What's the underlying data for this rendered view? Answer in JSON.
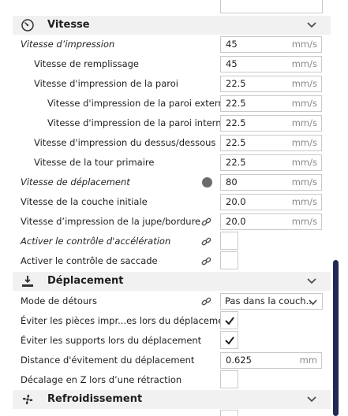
{
  "speed_section": {
    "title": "Vitesse",
    "rows": [
      {
        "label": "Vitesse d’impression",
        "value": "45",
        "unit": "mm/s"
      },
      {
        "label": "Vitesse de remplissage",
        "value": "45",
        "unit": "mm/s"
      },
      {
        "label": "Vitesse d'impression de la paroi",
        "value": "22.5",
        "unit": "mm/s"
      },
      {
        "label": "Vitesse d'impression de la paroi externe",
        "value": "22.5",
        "unit": "mm/s"
      },
      {
        "label": "Vitesse d'impression de la paroi interne",
        "value": "22.5",
        "unit": "mm/s"
      },
      {
        "label": "Vitesse d'impression du dessus/dessous",
        "value": "22.5",
        "unit": "mm/s"
      },
      {
        "label": "Vitesse de la tour primaire",
        "value": "22.5",
        "unit": "mm/s"
      },
      {
        "label": "Vitesse de déplacement",
        "value": "80",
        "unit": "mm/s"
      },
      {
        "label": "Vitesse de la couche initiale",
        "value": "20.0",
        "unit": "mm/s"
      },
      {
        "label": "Vitesse d’impression de la jupe/bordure",
        "value": "20.0",
        "unit": "mm/s"
      }
    ],
    "accel_label": "Activer le contrôle d'accélération",
    "jerk_label": "Activer le contrôle de saccade"
  },
  "travel_section": {
    "title": "Déplacement",
    "combing_label": "Mode de détours",
    "combing_value": "Pas dans la couch...",
    "avoid_parts_label": "Éviter les pièces impr...es lors du déplacement",
    "avoid_supports_label": "Éviter les supports lors du déplacement",
    "avoid_distance_label": "Distance d'évitement du déplacement",
    "avoid_distance_value": "0.625",
    "avoid_distance_unit": "mm",
    "zhop_label": "Décalage en Z lors d’une rétraction"
  },
  "cooling_section": {
    "title": "Refroidissement"
  },
  "icons": {
    "speed": "speedometer-icon",
    "travel": "travel-icon",
    "cooling": "fan-icon",
    "link": "link-icon",
    "info": "info-icon",
    "chevron": "chevron-down-icon",
    "check": "checkmark-icon"
  },
  "colors": {
    "section_bg": "#f1f1f1",
    "border": "#c9c9c9",
    "scrollbar": "#1f2a55"
  }
}
